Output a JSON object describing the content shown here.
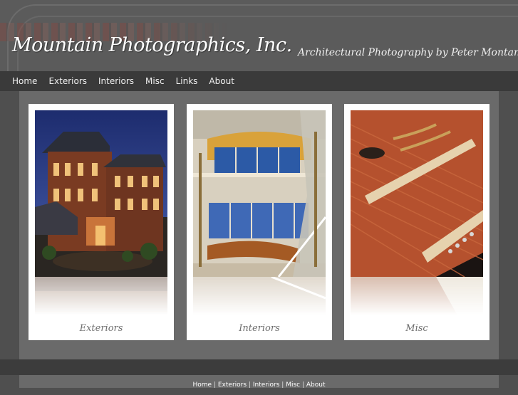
{
  "header": {
    "logo_text": "Mountain Photographics, Inc.",
    "tagline": "Architectural Photography by Peter Montanti"
  },
  "nav": {
    "items": [
      "Home",
      "Exteriors",
      "Interiors",
      "Misc",
      "Links",
      "About"
    ]
  },
  "gallery": {
    "cards": [
      {
        "label": "Exteriors",
        "icon": "victorian-building-photo"
      },
      {
        "label": "Interiors",
        "icon": "atrium-lobby-photo"
      },
      {
        "label": "Misc",
        "icon": "hammered-dulcimer-photo"
      }
    ]
  },
  "footer": {
    "links": [
      "Home",
      "Exteriors",
      "Interiors",
      "Misc",
      "About"
    ],
    "separator": "|"
  },
  "colors": {
    "page_bg": "#4f4f4f",
    "header_bg": "#5b5b5b",
    "nav_bg": "#3a3a3a",
    "content_bg": "#6a6a6a",
    "card_bg": "#ffffff",
    "label_text": "#6e6e6e"
  }
}
